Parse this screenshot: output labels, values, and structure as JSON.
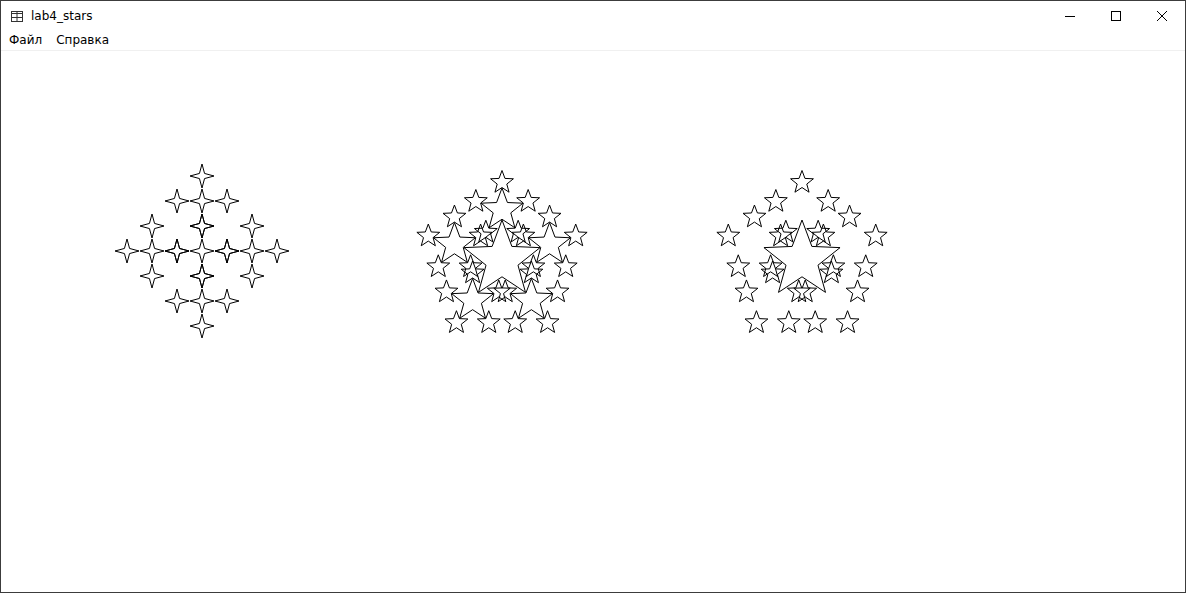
{
  "window": {
    "title": "lab4_stars"
  },
  "menu": [
    {
      "label": "Файл"
    },
    {
      "label": "Справка"
    }
  ],
  "figures": [
    {
      "kind": "diamond",
      "points": 4
    },
    {
      "kind": "nested",
      "points": 5
    },
    {
      "kind": "ring",
      "points": 5
    }
  ]
}
